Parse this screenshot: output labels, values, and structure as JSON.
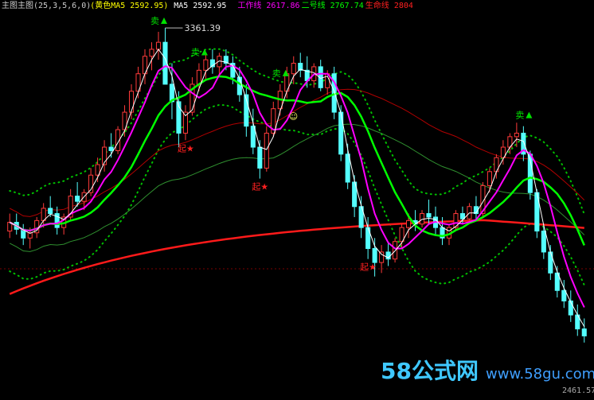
{
  "header": {
    "items": [
      {
        "text": "主图主图(25,3,5,6,0)",
        "color": "#cccccc"
      },
      {
        "text": "(黄色MA5 2592.95)",
        "color": "#ffff00"
      },
      {
        "text": "MA5 2592.95",
        "color": "#ffffff"
      },
      {
        "text": "工作线 2617.86",
        "color": "#ff00ff"
      },
      {
        "text": "二号线 2767.74",
        "color": "#00ff00"
      },
      {
        "text": "生命线 2804",
        "color": "#ff2020"
      }
    ]
  },
  "labels": {
    "peak_price": "3361.39",
    "low_price": "2461.57",
    "sell": "卖",
    "start": "起★",
    "smiley": "☺"
  },
  "watermark": {
    "brand": "58公式网",
    "url": "www.58gu.com"
  },
  "colors": {
    "background": "#000000",
    "candle_up": "#ff3a3a",
    "candle_down": "#54ffff",
    "ma_fast": "#ffffff",
    "ma_mid": "#ff00ff",
    "ma_slow": "#00ff00",
    "life_line": "#ff1a1a",
    "band_dots": "#00c000",
    "channel": "#b00000",
    "sell_marker": "#00e000",
    "start_marker": "#ff2020"
  },
  "chart_data": {
    "type": "candlestick",
    "price_range": [
      2440,
      3400
    ],
    "candles": [
      [
        2780,
        2830,
        2760,
        2805
      ],
      [
        2805,
        2830,
        2770,
        2785
      ],
      [
        2785,
        2800,
        2740,
        2760
      ],
      [
        2760,
        2790,
        2730,
        2775
      ],
      [
        2775,
        2820,
        2760,
        2810
      ],
      [
        2810,
        2860,
        2790,
        2845
      ],
      [
        2845,
        2880,
        2820,
        2830
      ],
      [
        2830,
        2850,
        2770,
        2790
      ],
      [
        2790,
        2830,
        2770,
        2820
      ],
      [
        2820,
        2900,
        2810,
        2880
      ],
      [
        2880,
        2920,
        2850,
        2865
      ],
      [
        2865,
        2900,
        2840,
        2890
      ],
      [
        2890,
        2960,
        2880,
        2940
      ],
      [
        2940,
        2990,
        2920,
        2970
      ],
      [
        2970,
        3040,
        2950,
        3020
      ],
      [
        3020,
        3060,
        2990,
        3010
      ],
      [
        3010,
        3080,
        3000,
        3070
      ],
      [
        3070,
        3140,
        3050,
        3120
      ],
      [
        3120,
        3200,
        3100,
        3180
      ],
      [
        3180,
        3250,
        3160,
        3230
      ],
      [
        3230,
        3300,
        3200,
        3280
      ],
      [
        3280,
        3320,
        3240,
        3300
      ],
      [
        3300,
        3350,
        3270,
        3320
      ],
      [
        3320,
        3361,
        3290,
        3200
      ],
      [
        3200,
        3260,
        3100,
        3150
      ],
      [
        3150,
        3180,
        3020,
        3060
      ],
      [
        3060,
        3140,
        3040,
        3120
      ],
      [
        3120,
        3220,
        3110,
        3200
      ],
      [
        3200,
        3260,
        3180,
        3240
      ],
      [
        3240,
        3290,
        3210,
        3270
      ],
      [
        3270,
        3300,
        3230,
        3250
      ],
      [
        3250,
        3290,
        3220,
        3280
      ],
      [
        3280,
        3300,
        3240,
        3260
      ],
      [
        3260,
        3280,
        3200,
        3220
      ],
      [
        3220,
        3250,
        3150,
        3170
      ],
      [
        3170,
        3200,
        3050,
        3080
      ],
      [
        3080,
        3130,
        3000,
        3020
      ],
      [
        3020,
        3040,
        2930,
        2960
      ],
      [
        2960,
        3080,
        2950,
        3060
      ],
      [
        3060,
        3150,
        3050,
        3130
      ],
      [
        3130,
        3200,
        3110,
        3180
      ],
      [
        3180,
        3250,
        3160,
        3230
      ],
      [
        3230,
        3280,
        3200,
        3260
      ],
      [
        3260,
        3290,
        3220,
        3240
      ],
      [
        3240,
        3280,
        3190,
        3210
      ],
      [
        3210,
        3260,
        3190,
        3250
      ],
      [
        3250,
        3270,
        3180,
        3190
      ],
      [
        3190,
        3240,
        3170,
        3230
      ],
      [
        3230,
        3250,
        3100,
        3120
      ],
      [
        3120,
        3140,
        2980,
        3000
      ],
      [
        3000,
        3030,
        2900,
        2920
      ],
      [
        2920,
        2940,
        2820,
        2850
      ],
      [
        2850,
        2880,
        2760,
        2790
      ],
      [
        2790,
        2820,
        2700,
        2730
      ],
      [
        2730,
        2760,
        2650,
        2690
      ],
      [
        2690,
        2740,
        2660,
        2720
      ],
      [
        2720,
        2750,
        2680,
        2700
      ],
      [
        2700,
        2760,
        2690,
        2750
      ],
      [
        2750,
        2800,
        2730,
        2790
      ],
      [
        2790,
        2830,
        2760,
        2810
      ],
      [
        2810,
        2840,
        2780,
        2800
      ],
      [
        2800,
        2840,
        2790,
        2830
      ],
      [
        2830,
        2870,
        2800,
        2820
      ],
      [
        2820,
        2850,
        2770,
        2790
      ],
      [
        2790,
        2820,
        2740,
        2760
      ],
      [
        2760,
        2800,
        2740,
        2790
      ],
      [
        2790,
        2840,
        2780,
        2830
      ],
      [
        2830,
        2850,
        2800,
        2815
      ],
      [
        2815,
        2860,
        2810,
        2850
      ],
      [
        2850,
        2880,
        2810,
        2830
      ],
      [
        2830,
        2920,
        2820,
        2910
      ],
      [
        2910,
        2960,
        2890,
        2950
      ],
      [
        2950,
        3000,
        2930,
        2990
      ],
      [
        2990,
        3040,
        2970,
        3020
      ],
      [
        3020,
        3060,
        3000,
        3050
      ],
      [
        3050,
        3090,
        3020,
        3060
      ],
      [
        3060,
        3080,
        2980,
        3000
      ],
      [
        3000,
        3010,
        2870,
        2890
      ],
      [
        2890,
        2900,
        2760,
        2780
      ],
      [
        2780,
        2800,
        2700,
        2720
      ],
      [
        2720,
        2740,
        2640,
        2660
      ],
      [
        2660,
        2680,
        2590,
        2610
      ],
      [
        2610,
        2640,
        2560,
        2580
      ],
      [
        2580,
        2610,
        2520,
        2540
      ],
      [
        2540,
        2570,
        2480,
        2500
      ],
      [
        2500,
        2530,
        2461,
        2480
      ]
    ]
  }
}
